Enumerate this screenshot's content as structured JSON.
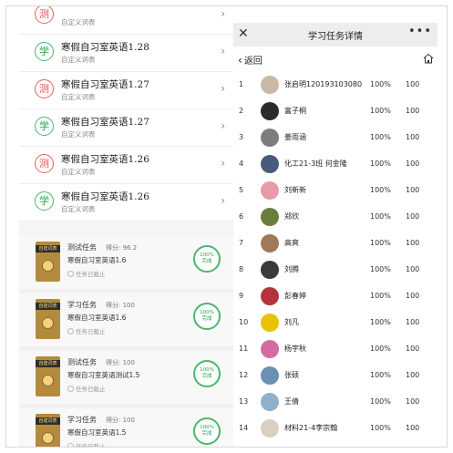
{
  "homework_list": [
    {
      "badge": "测",
      "badge_color": "red",
      "title": "",
      "subtitle": "自定义词表"
    },
    {
      "badge": "学",
      "badge_color": "green",
      "title": "寒假自习室英语1.28",
      "subtitle": "自定义词表"
    },
    {
      "badge": "测",
      "badge_color": "red",
      "title": "寒假自习室英语1.27",
      "subtitle": "自定义词表"
    },
    {
      "badge": "学",
      "badge_color": "green",
      "title": "寒假自习室英语1.27",
      "subtitle": "自定义词表"
    },
    {
      "badge": "测",
      "badge_color": "red",
      "title": "寒假自习室英语1.26",
      "subtitle": "自定义词表"
    },
    {
      "badge": "学",
      "badge_color": "green",
      "title": "寒假自习室英语1.26",
      "subtitle": "自定义词表"
    }
  ],
  "tasks": [
    {
      "book_label": "自建词表",
      "type": "测试任务",
      "score": "得分: 96.2",
      "name": "寒假自习室英语1.6",
      "status": "任务已截止",
      "progress_value": "100%",
      "progress_label": "完成"
    },
    {
      "book_label": "自建词表",
      "type": "学习任务",
      "score": "得分: 100",
      "name": "寒假自习室英语1.6",
      "status": "任务已截止",
      "progress_value": "100%",
      "progress_label": "完成"
    },
    {
      "book_label": "自建词表",
      "type": "测试任务",
      "score": "得分: 100",
      "name": "寒假自习室英语测试1.5",
      "status": "任务已截止",
      "progress_value": "100%",
      "progress_label": "完成"
    },
    {
      "book_label": "自建词表",
      "type": "学习任务",
      "score": "得分: 100",
      "name": "寒假自习室英语1.5",
      "status": "任务已截止",
      "progress_value": "100%",
      "progress_label": "完成"
    }
  ],
  "detail": {
    "title": "学习任务详情",
    "back_label": "返回",
    "students": [
      {
        "rank": "1",
        "name": "张启明120193103080",
        "pct": "100%",
        "score": "100",
        "avatar_color": "#c9b8a6"
      },
      {
        "rank": "2",
        "name": "富子桐",
        "pct": "100%",
        "score": "100",
        "avatar_color": "#2b2b2b"
      },
      {
        "rank": "3",
        "name": "姜雨涵",
        "pct": "100%",
        "score": "100",
        "avatar_color": "#7d7d7d"
      },
      {
        "rank": "4",
        "name": "化工21-3班 何金隆",
        "pct": "100%",
        "score": "100",
        "avatar_color": "#4a5a7a"
      },
      {
        "rank": "5",
        "name": "刘新新",
        "pct": "100%",
        "score": "100",
        "avatar_color": "#e79aa8"
      },
      {
        "rank": "6",
        "name": "郑欣",
        "pct": "100%",
        "score": "100",
        "avatar_color": "#6b7d3a"
      },
      {
        "rank": "7",
        "name": "高爽",
        "pct": "100%",
        "score": "100",
        "avatar_color": "#a0785a"
      },
      {
        "rank": "8",
        "name": "刘腾",
        "pct": "100%",
        "score": "100",
        "avatar_color": "#3a3a3a"
      },
      {
        "rank": "9",
        "name": "彭春婷",
        "pct": "100%",
        "score": "100",
        "avatar_color": "#b3343a"
      },
      {
        "rank": "10",
        "name": "刘凡",
        "pct": "100%",
        "score": "100",
        "avatar_color": "#e6c200"
      },
      {
        "rank": "11",
        "name": "杨宇秋",
        "pct": "100%",
        "score": "100",
        "avatar_color": "#d46aa0"
      },
      {
        "rank": "12",
        "name": "张硕",
        "pct": "100%",
        "score": "100",
        "avatar_color": "#6d8fb3"
      },
      {
        "rank": "13",
        "name": "王倩",
        "pct": "100%",
        "score": "100",
        "avatar_color": "#8fb1c9"
      },
      {
        "rank": "14",
        "name": "材料21-4李宗翰",
        "pct": "100%",
        "score": "100",
        "avatar_color": "#d9d0c3"
      }
    ]
  }
}
